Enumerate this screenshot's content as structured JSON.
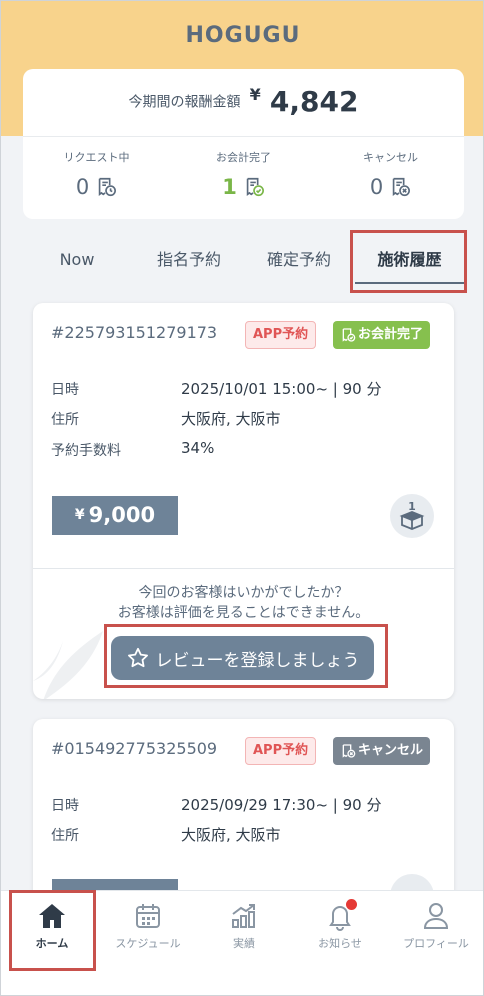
{
  "app": {
    "title": "HOGUGU"
  },
  "summary": {
    "reward_label": "今期間の報酬金額",
    "reward_currency": "¥",
    "reward_value": "4,842",
    "stats": [
      {
        "label": "リクエスト中",
        "count": "0",
        "icon": "receipt-clock-icon"
      },
      {
        "label": "お会計完了",
        "count": "1",
        "icon": "receipt-check-icon"
      },
      {
        "label": "キャンセル",
        "count": "0",
        "icon": "receipt-cancel-icon"
      }
    ]
  },
  "tabs": [
    {
      "label": "Now"
    },
    {
      "label": "指名予約"
    },
    {
      "label": "確定予約"
    },
    {
      "label": "施術履歴",
      "active": true
    }
  ],
  "orders": [
    {
      "id": "#225793151279173",
      "badge_type": "APP予約",
      "status": "お会計完了",
      "status_color": "#86c04e",
      "date_label": "日時",
      "date_value": "2025/10/01 15:00~ | 90 分",
      "address_label": "住所",
      "address_value": "大阪府, 大阪市",
      "fee_label": "予約手数料",
      "fee_value": "34%",
      "price_currency": "¥",
      "price": "9,000",
      "review_question": "今回のお客様はいかがでしたか？",
      "review_note": "お客様は評価を見ることはできません。",
      "review_button": "レビューを登録しましょう"
    },
    {
      "id": "#015492775325509",
      "badge_type": "APP予約",
      "status": "キャンセル",
      "status_color": "#7a8591",
      "date_label": "日時",
      "date_value": "2025/09/29 17:30~ | 90 分",
      "address_label": "住所",
      "address_value": "大阪府, 大阪市"
    }
  ],
  "nav": [
    {
      "label": "ホーム",
      "icon": "home-icon",
      "active": true
    },
    {
      "label": "スケジュール",
      "icon": "calendar-icon"
    },
    {
      "label": "実績",
      "icon": "chart-icon"
    },
    {
      "label": "お知らせ",
      "icon": "bell-icon"
    },
    {
      "label": "プロフィール",
      "icon": "profile-icon"
    }
  ],
  "colors": {
    "header": "#f8d38c",
    "accent": "#6e8398",
    "done": "#86c04e",
    "cancel": "#7a8591",
    "highlight": "#c8514c",
    "notification": "#e53935"
  }
}
